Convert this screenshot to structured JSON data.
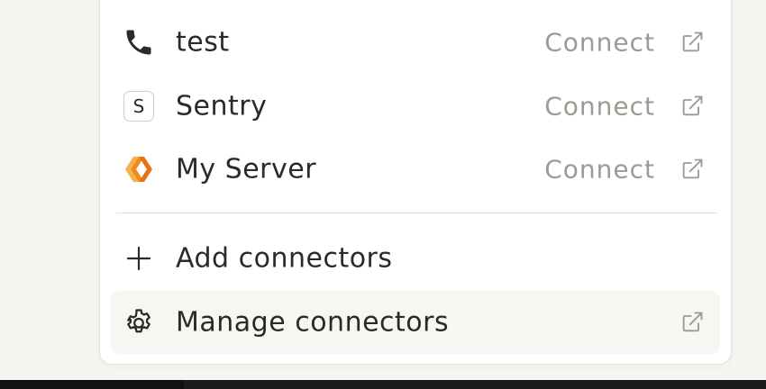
{
  "connectors": [
    {
      "name": "test",
      "action": "Connect",
      "icon": "phone-icon"
    },
    {
      "name": "Sentry",
      "action": "Connect",
      "icon": "sentry-logo",
      "badge_letter": "S"
    },
    {
      "name": "My Server",
      "action": "Connect",
      "icon": "server-logo-icon"
    }
  ],
  "footer": {
    "add_label": "Add connectors",
    "add_icon": "plus-icon",
    "manage_label": "Manage connectors",
    "manage_icon": "gear-icon"
  },
  "colors": {
    "label_text": "#2b2a27",
    "muted_text": "#9c9a93",
    "hover_bg": "#f6f6f2",
    "server_logo_orange": "#f08a1c"
  }
}
